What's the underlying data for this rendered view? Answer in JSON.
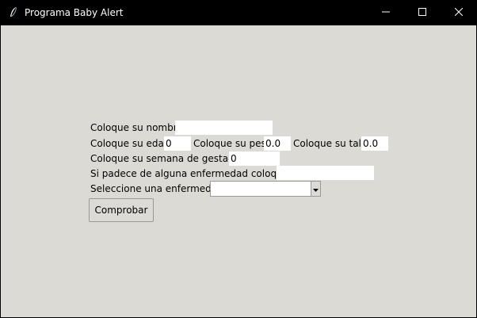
{
  "window": {
    "title": "Programa Baby Alert",
    "app_icon": "feather-icon",
    "controls": {
      "minimize_icon": "minimize-icon",
      "maximize_icon": "maximize-icon",
      "close_icon": "close-icon"
    }
  },
  "form": {
    "nombre": {
      "label": "Coloque su nombre",
      "value": ""
    },
    "edad": {
      "label": "Coloque su edad:",
      "value": "0"
    },
    "peso": {
      "label": "Coloque su peso",
      "value": "0.0"
    },
    "talla": {
      "label": "Coloque su talla",
      "value": "0.0"
    },
    "gestacion": {
      "label": "Coloque su semana de gestación",
      "value": "0"
    },
    "enfermedad_texto": {
      "label": "Si padece de alguna enfermedad coloquela:",
      "value": ""
    },
    "enfermedad_select": {
      "label": "Seleccione una enfermedad:",
      "value": ""
    },
    "submit_label": "Comprobar"
  },
  "colors": {
    "background": "#dcdad5",
    "titlebar": "#000000",
    "entry": "#ffffff"
  }
}
